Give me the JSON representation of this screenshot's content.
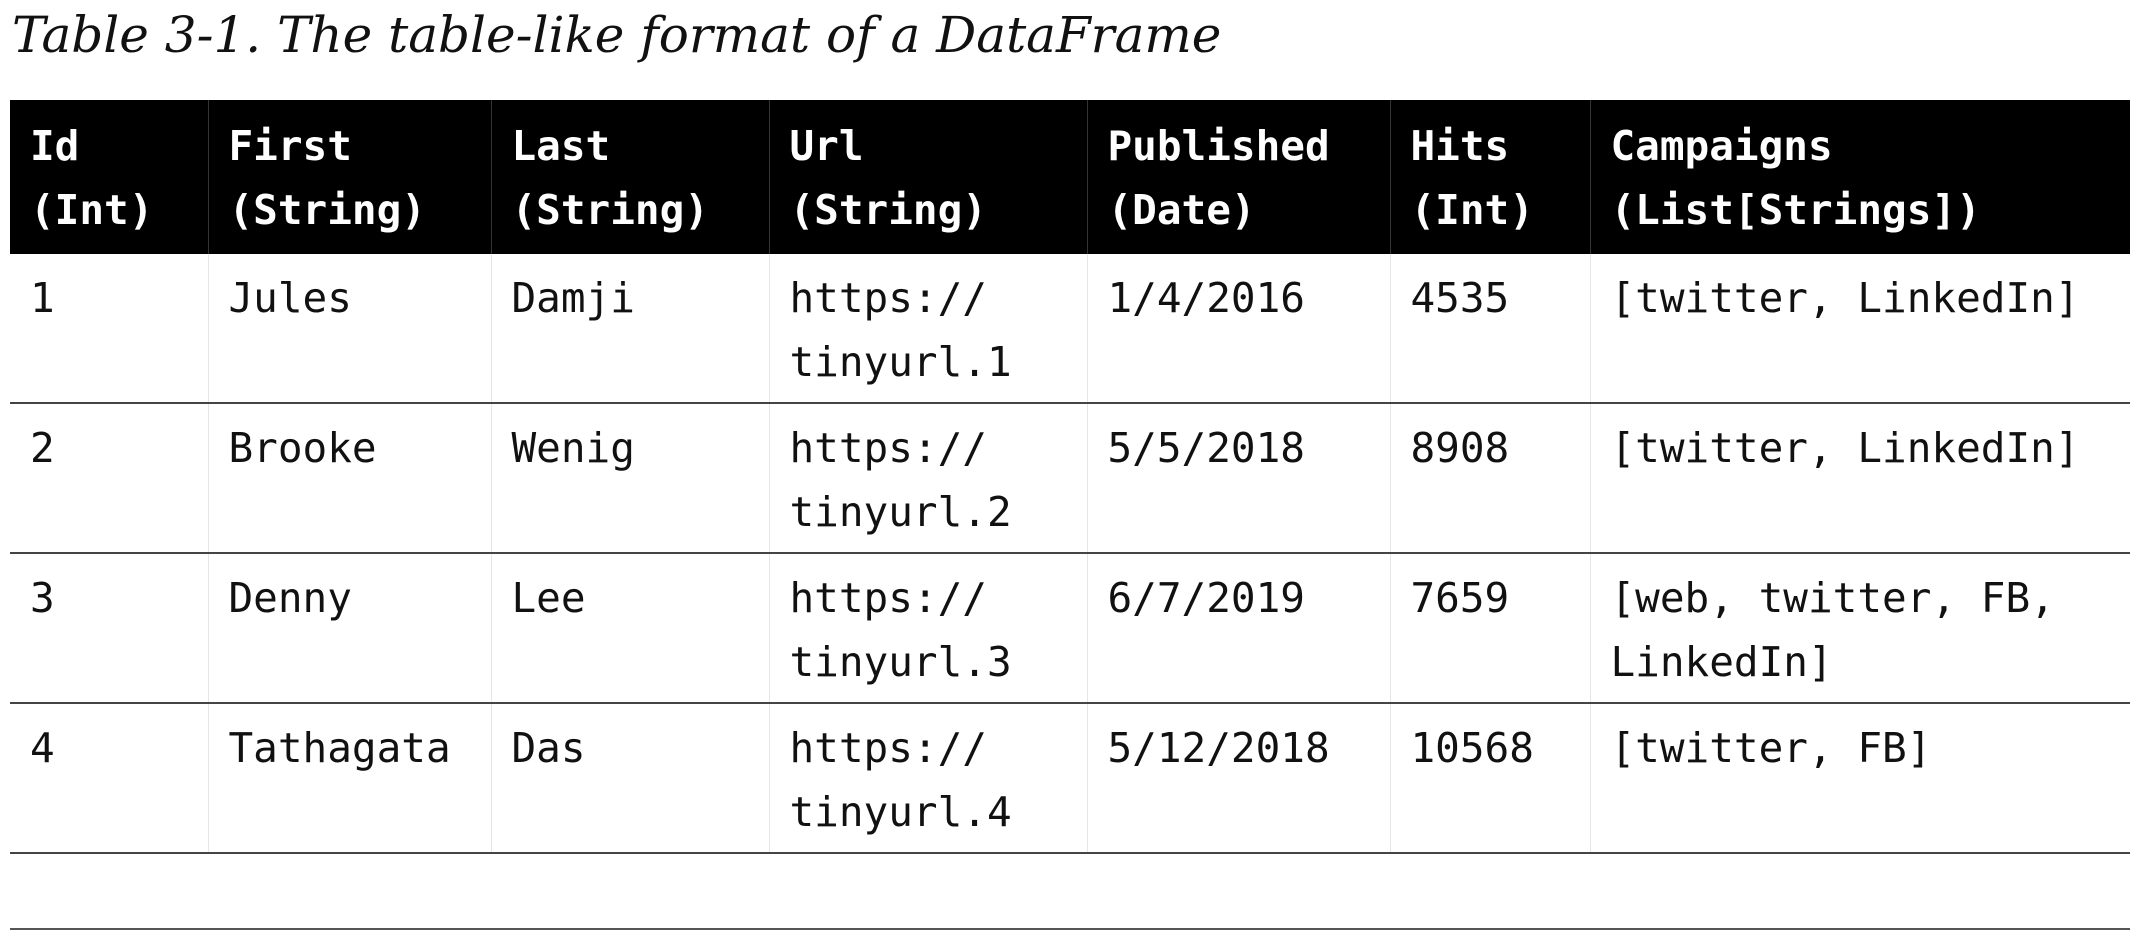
{
  "caption": "Table 3-1. The table-like format of a DataFrame",
  "columns": [
    {
      "name": "Id",
      "type": "(Int)"
    },
    {
      "name": "First",
      "type": "(String)"
    },
    {
      "name": "Last",
      "type": "(String)"
    },
    {
      "name": "Url",
      "type": "(String)"
    },
    {
      "name": "Published",
      "type": "(Date)"
    },
    {
      "name": "Hits",
      "type": "(Int)"
    },
    {
      "name": "Campaigns",
      "type": "(List[Strings])"
    }
  ],
  "rows": [
    {
      "id": "1",
      "first": "Jules",
      "last": "Damji",
      "url": [
        "https://",
        "tinyurl.1"
      ],
      "published": "1/4/2016",
      "hits": "4535",
      "campaigns": [
        "[twitter, LinkedIn]"
      ]
    },
    {
      "id": "2",
      "first": "Brooke",
      "last": "Wenig",
      "url": [
        "https://",
        "tinyurl.2"
      ],
      "published": "5/5/2018",
      "hits": "8908",
      "campaigns": [
        "[twitter, LinkedIn]"
      ]
    },
    {
      "id": "3",
      "first": "Denny",
      "last": "Lee",
      "url": [
        "https://",
        "tinyurl.3"
      ],
      "published": "6/7/2019",
      "hits": "7659",
      "campaigns": [
        "[web, twitter, FB,",
        "LinkedIn]"
      ]
    },
    {
      "id": "4",
      "first": "Tathagata",
      "last": "Das",
      "url": [
        "https://",
        "tinyurl.4"
      ],
      "published": "5/12/2018",
      "hits": "10568",
      "campaigns": [
        "[twitter, FB]"
      ]
    }
  ],
  "colors": {
    "header_background": "#000000",
    "header_text": "#ffffff",
    "body_text": "#111111"
  }
}
